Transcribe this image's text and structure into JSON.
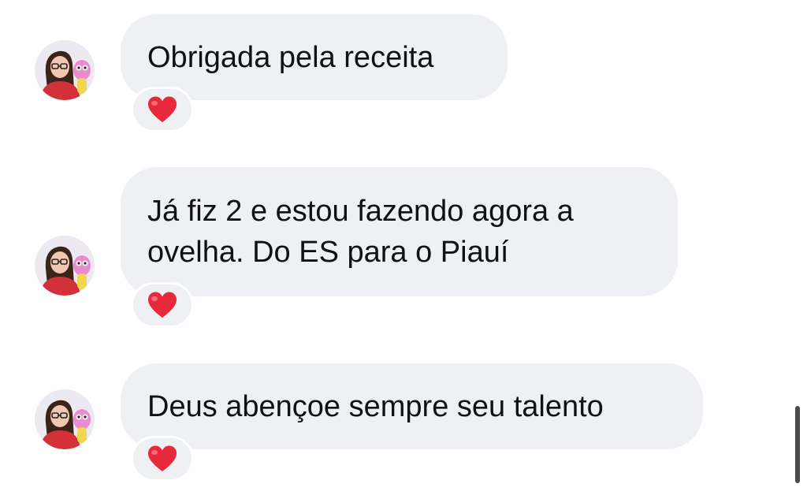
{
  "conversation": {
    "messages": [
      {
        "text": "Obrigada pela receita",
        "reaction": "red-heart"
      },
      {
        "text": "Já fiz 2 e estou fazendo agora a\novelha. Do ES para o Piauí",
        "reaction": "red-heart"
      },
      {
        "text": "Deus abençoe sempre seu talento",
        "reaction": "red-heart"
      }
    ]
  },
  "colors": {
    "bubble_background": "#eff0f4",
    "message_text": "#101114",
    "heart": "#e8293b",
    "scrollbar": "#4a4a4f"
  },
  "icons": {
    "avatar": "user-avatar-photo",
    "reaction": "red-heart-icon"
  }
}
